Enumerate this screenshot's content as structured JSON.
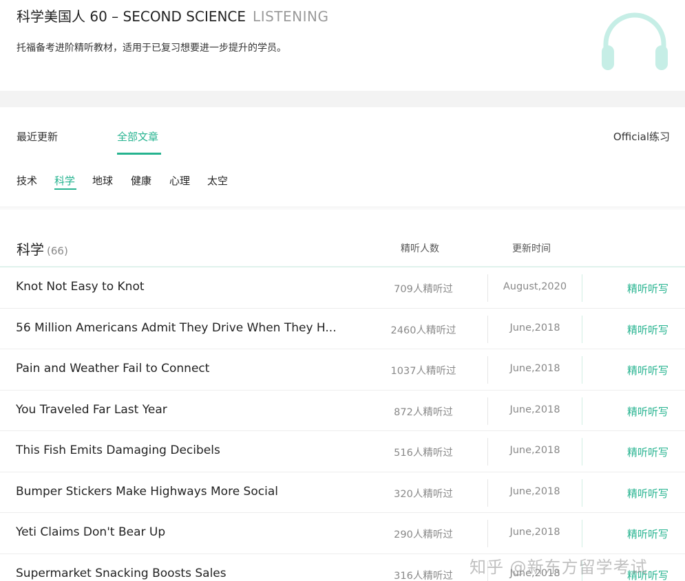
{
  "header": {
    "title_main": "科学美国人 60 – SECOND SCIENCE",
    "title_sub": "LISTENING",
    "description": "托福备考进阶精听教材，适用于已复习想要进一步提升的学员。",
    "icon": "headphones-icon"
  },
  "tabs": [
    {
      "label": "最近更新",
      "active": false
    },
    {
      "label": "全部文章",
      "active": true
    }
  ],
  "official_label": "Official练习",
  "categories": [
    {
      "label": "技术",
      "active": false
    },
    {
      "label": "科学",
      "active": true
    },
    {
      "label": "地球",
      "active": false
    },
    {
      "label": "健康",
      "active": false
    },
    {
      "label": "心理",
      "active": false
    },
    {
      "label": "太空",
      "active": false
    }
  ],
  "list": {
    "title": "科学",
    "count": "(66)",
    "col_listeners": "精听人数",
    "col_updated": "更新时间",
    "rows": [
      {
        "title": "Knot Not Easy to Knot",
        "listeners": "709人精听过",
        "date": "August,2020",
        "action": "精听听写"
      },
      {
        "title": "56 Million Americans Admit They Drive When They H...",
        "listeners": "2460人精听过",
        "date": "June,2018",
        "action": "精听听写"
      },
      {
        "title": "Pain and Weather Fail to Connect",
        "listeners": "1037人精听过",
        "date": "June,2018",
        "action": "精听听写"
      },
      {
        "title": "You Traveled Far Last Year",
        "listeners": "872人精听过",
        "date": "June,2018",
        "action": "精听听写"
      },
      {
        "title": "This Fish Emits Damaging Decibels",
        "listeners": "516人精听过",
        "date": "June,2018",
        "action": "精听听写"
      },
      {
        "title": "Bumper Stickers Make Highways More Social",
        "listeners": "320人精听过",
        "date": "June,2018",
        "action": "精听听写"
      },
      {
        "title": "Yeti Claims Don't Bear Up",
        "listeners": "290人精听过",
        "date": "June,2018",
        "action": "精听听写"
      },
      {
        "title": "Supermarket Snacking Boosts Sales",
        "listeners": "316人精听过",
        "date": "June,2018",
        "action": "精听听写"
      }
    ]
  },
  "watermark": "知乎 @新东方留学考试",
  "colors": {
    "accent": "#25b38f",
    "icon": "#c6eee6"
  }
}
